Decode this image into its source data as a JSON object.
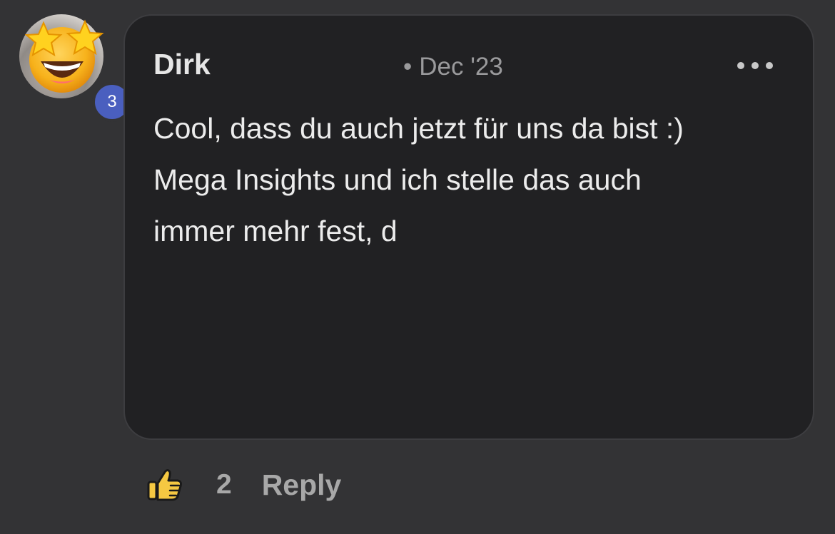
{
  "comment": {
    "author": "Dirk",
    "date_prefix": "•",
    "date": "Dec '23",
    "avatar_badge": "3",
    "avatar_icon": "star-struck-emoji",
    "more_icon": "more-horizontal-icon",
    "text_lines": [
      "Cool, dass du auch jetzt für uns da bist :)",
      "Mega Insights und ich stelle das auch",
      "immer mehr fest, d"
    ]
  },
  "actions": {
    "like_icon": "thumbs-up-icon",
    "like_count": "2",
    "reply_label": "Reply"
  },
  "colors": {
    "background": "#333335",
    "bubble": "#212123",
    "badge": "#4a5fbf",
    "text": "#ececec",
    "muted": "#9a9a9c"
  }
}
